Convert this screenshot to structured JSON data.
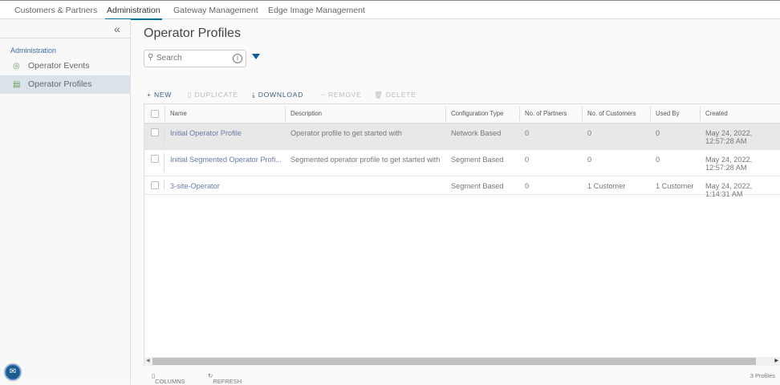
{
  "topnav": {
    "tabs": [
      {
        "label": "Customers & Partners"
      },
      {
        "label": "Administration",
        "active": true
      },
      {
        "label": "Gateway Management"
      },
      {
        "label": "Edge Image Management"
      }
    ]
  },
  "sidebar": {
    "section": "Administration",
    "items": [
      {
        "label": "Operator Events",
        "icon": "events-icon"
      },
      {
        "label": "Operator Profiles",
        "icon": "profiles-icon",
        "active": true
      }
    ]
  },
  "main": {
    "title": "Operator Profiles",
    "search_placeholder": "Search",
    "actions": {
      "new": "NEW",
      "duplicate": "DUPLICATE",
      "download": "DOWNLOAD",
      "remove": "REMOVE",
      "delete": "DELETE"
    },
    "columns": [
      "Name",
      "Description",
      "Configuration Type",
      "No. of Partners",
      "No. of Customers",
      "Used By",
      "Created"
    ],
    "rows": [
      {
        "name": "Initial Operator Profile",
        "description": "Operator profile to get started with",
        "config": "Network Based",
        "partners": "0",
        "customers": "0",
        "used_by": "0",
        "created": "May 24, 2022, 12:57:28 AM"
      },
      {
        "name": "Initial Segmented Operator Profi...",
        "description": "Segmented operator profile to get started with",
        "config": "Segment Based",
        "partners": "0",
        "customers": "0",
        "used_by": "0",
        "created": "May 24, 2022, 12:57:28 AM"
      },
      {
        "name": "3-site-Operator",
        "description": "",
        "config": "Segment Based",
        "partners": "0",
        "customers": "1 Customer",
        "used_by": "1 Customer",
        "created": "May 24, 2022, 1:14:31 AM"
      }
    ],
    "footer": {
      "columns": "COLUMNS",
      "refresh": "REFRESH",
      "count": "3 Profiles"
    }
  },
  "colors": {
    "accent": "#0072a3",
    "link": "#6b79a8",
    "selected_row": "#e8e8e8"
  }
}
